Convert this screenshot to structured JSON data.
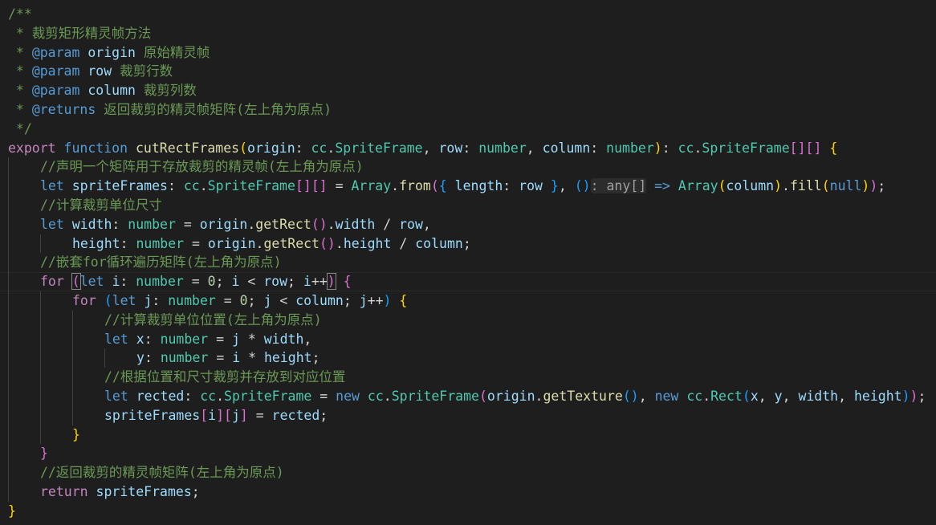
{
  "theme": {
    "background": "#1e1e1e",
    "comment": "#6a9955",
    "keyword": "#569cd6",
    "control": "#c586c0",
    "function": "#dcdcaa",
    "type": "#4ec9b0",
    "variable": "#9cdcfe",
    "number": "#b5cea8",
    "plain": "#d4d4d4",
    "bracket1": "#ffd700",
    "bracket2": "#da70d6",
    "bracket3": "#179fff"
  },
  "editor": {
    "lines": [
      {
        "indent": 0,
        "tokens": [
          [
            "/**",
            "comment"
          ]
        ]
      },
      {
        "indent": 0,
        "tokens": [
          [
            " * 裁剪矩形精灵帧方法",
            "comment"
          ]
        ]
      },
      {
        "indent": 0,
        "tokens": [
          [
            " * ",
            "comment"
          ],
          [
            "@param",
            "keyword"
          ],
          [
            " ",
            "comment"
          ],
          [
            "origin",
            "variable"
          ],
          [
            " 原始精灵帧",
            "comment"
          ]
        ]
      },
      {
        "indent": 0,
        "tokens": [
          [
            " * ",
            "comment"
          ],
          [
            "@param",
            "keyword"
          ],
          [
            " ",
            "comment"
          ],
          [
            "row",
            "variable"
          ],
          [
            " 裁剪行数",
            "comment"
          ]
        ]
      },
      {
        "indent": 0,
        "tokens": [
          [
            " * ",
            "comment"
          ],
          [
            "@param",
            "keyword"
          ],
          [
            " ",
            "comment"
          ],
          [
            "column",
            "variable"
          ],
          [
            " 裁剪列数",
            "comment"
          ]
        ]
      },
      {
        "indent": 0,
        "tokens": [
          [
            " * ",
            "comment"
          ],
          [
            "@returns",
            "keyword"
          ],
          [
            " 返回裁剪的精灵帧矩阵(左上角为原点)",
            "comment"
          ]
        ]
      },
      {
        "indent": 0,
        "tokens": [
          [
            " */",
            "comment"
          ]
        ]
      },
      {
        "indent": 0,
        "tokens": [
          [
            "export",
            "control"
          ],
          [
            " ",
            "plain"
          ],
          [
            "function",
            "keyword"
          ],
          [
            " ",
            "plain"
          ],
          [
            "cutRectFrames",
            "function"
          ],
          [
            "(",
            "bracket1"
          ],
          [
            "origin",
            "variable"
          ],
          [
            ": ",
            "plain"
          ],
          [
            "cc",
            "type"
          ],
          [
            ".",
            "plain"
          ],
          [
            "SpriteFrame",
            "type"
          ],
          [
            ", ",
            "plain"
          ],
          [
            "row",
            "variable"
          ],
          [
            ": ",
            "plain"
          ],
          [
            "number",
            "type"
          ],
          [
            ", ",
            "plain"
          ],
          [
            "column",
            "variable"
          ],
          [
            ": ",
            "plain"
          ],
          [
            "number",
            "type"
          ],
          [
            ")",
            "bracket1"
          ],
          [
            ": ",
            "plain"
          ],
          [
            "cc",
            "type"
          ],
          [
            ".",
            "plain"
          ],
          [
            "SpriteFrame",
            "type"
          ],
          [
            "[]",
            "bracket2"
          ],
          [
            "[]",
            "bracket2"
          ],
          [
            " ",
            "plain"
          ],
          [
            "{",
            "bracket1"
          ]
        ]
      },
      {
        "indent": 1,
        "tokens": [
          [
            "//声明一个矩阵用于存放裁剪的精灵帧(左上角为原点)",
            "comment"
          ]
        ]
      },
      {
        "indent": 1,
        "tokens": [
          [
            "let",
            "keyword"
          ],
          [
            " ",
            "plain"
          ],
          [
            "spriteFrames",
            "variable"
          ],
          [
            ": ",
            "plain"
          ],
          [
            "cc",
            "type"
          ],
          [
            ".",
            "plain"
          ],
          [
            "SpriteFrame",
            "type"
          ],
          [
            "[]",
            "bracket2"
          ],
          [
            "[]",
            "bracket2"
          ],
          [
            " = ",
            "plain"
          ],
          [
            "Array",
            "type"
          ],
          [
            ".",
            "plain"
          ],
          [
            "from",
            "function"
          ],
          [
            "(",
            "bracket2"
          ],
          [
            "{",
            "bracket3"
          ],
          [
            " ",
            "plain"
          ],
          [
            "length",
            "variable"
          ],
          [
            ": ",
            "plain"
          ],
          [
            "row",
            "variable"
          ],
          [
            " ",
            "plain"
          ],
          [
            "}",
            "bracket3"
          ],
          [
            ", ",
            "plain"
          ],
          [
            "()",
            "bracket3"
          ],
          [
            "hint:: any[]",
            "hint"
          ],
          [
            " => ",
            "keyword"
          ],
          [
            "Array",
            "type"
          ],
          [
            "(",
            "bracket1"
          ],
          [
            "column",
            "variable"
          ],
          [
            ")",
            "bracket1"
          ],
          [
            ".",
            "plain"
          ],
          [
            "fill",
            "function"
          ],
          [
            "(",
            "bracket1"
          ],
          [
            "null",
            "keyword"
          ],
          [
            ")",
            "bracket1"
          ],
          [
            ")",
            "bracket2"
          ],
          [
            ";",
            "plain"
          ]
        ]
      },
      {
        "indent": 1,
        "tokens": [
          [
            "//计算裁剪单位尺寸",
            "comment"
          ]
        ]
      },
      {
        "indent": 1,
        "tokens": [
          [
            "let",
            "keyword"
          ],
          [
            " ",
            "plain"
          ],
          [
            "width",
            "variable"
          ],
          [
            ": ",
            "plain"
          ],
          [
            "number",
            "type"
          ],
          [
            " = ",
            "plain"
          ],
          [
            "origin",
            "variable"
          ],
          [
            ".",
            "plain"
          ],
          [
            "getRect",
            "function"
          ],
          [
            "()",
            "bracket2"
          ],
          [
            ".",
            "plain"
          ],
          [
            "width",
            "variable"
          ],
          [
            " / ",
            "plain"
          ],
          [
            "row",
            "variable"
          ],
          [
            ",",
            "plain"
          ]
        ]
      },
      {
        "indent": 2,
        "tokens": [
          [
            "height",
            "variable"
          ],
          [
            ": ",
            "plain"
          ],
          [
            "number",
            "type"
          ],
          [
            " = ",
            "plain"
          ],
          [
            "origin",
            "variable"
          ],
          [
            ".",
            "plain"
          ],
          [
            "getRect",
            "function"
          ],
          [
            "()",
            "bracket2"
          ],
          [
            ".",
            "plain"
          ],
          [
            "height",
            "variable"
          ],
          [
            " / ",
            "plain"
          ],
          [
            "column",
            "variable"
          ],
          [
            ";",
            "plain"
          ]
        ]
      },
      {
        "indent": 1,
        "tokens": [
          [
            "//嵌套for循环遍历矩阵(左上角为原点)",
            "comment"
          ]
        ]
      },
      {
        "indent": 1,
        "current": true,
        "tokens": [
          [
            "for",
            "control"
          ],
          [
            " ",
            "plain"
          ],
          [
            "(",
            "bracket2box"
          ],
          [
            "let",
            "keyword"
          ],
          [
            " ",
            "plain"
          ],
          [
            "i",
            "variable"
          ],
          [
            ": ",
            "plain"
          ],
          [
            "number",
            "type"
          ],
          [
            " = ",
            "plain"
          ],
          [
            "0",
            "number"
          ],
          [
            "; ",
            "plain"
          ],
          [
            "i",
            "variable"
          ],
          [
            " < ",
            "plain"
          ],
          [
            "row",
            "variable"
          ],
          [
            "; ",
            "plain"
          ],
          [
            "i",
            "variable"
          ],
          [
            "++",
            "plain"
          ],
          [
            ")",
            "bracket2box"
          ],
          [
            " ",
            "plain"
          ],
          [
            "{",
            "bracket2"
          ]
        ]
      },
      {
        "indent": 2,
        "tokens": [
          [
            "for",
            "control"
          ],
          [
            " ",
            "plain"
          ],
          [
            "(",
            "bracket3"
          ],
          [
            "let",
            "keyword"
          ],
          [
            " ",
            "plain"
          ],
          [
            "j",
            "variable"
          ],
          [
            ": ",
            "plain"
          ],
          [
            "number",
            "type"
          ],
          [
            " = ",
            "plain"
          ],
          [
            "0",
            "number"
          ],
          [
            "; ",
            "plain"
          ],
          [
            "j",
            "variable"
          ],
          [
            " < ",
            "plain"
          ],
          [
            "column",
            "variable"
          ],
          [
            "; ",
            "plain"
          ],
          [
            "j",
            "variable"
          ],
          [
            "++",
            "plain"
          ],
          [
            ")",
            "bracket3"
          ],
          [
            " ",
            "plain"
          ],
          [
            "{",
            "bracket1"
          ]
        ]
      },
      {
        "indent": 3,
        "tokens": [
          [
            "//计算裁剪单位位置(左上角为原点)",
            "comment"
          ]
        ]
      },
      {
        "indent": 3,
        "tokens": [
          [
            "let",
            "keyword"
          ],
          [
            " ",
            "plain"
          ],
          [
            "x",
            "variable"
          ],
          [
            ": ",
            "plain"
          ],
          [
            "number",
            "type"
          ],
          [
            " = ",
            "plain"
          ],
          [
            "j",
            "variable"
          ],
          [
            " * ",
            "plain"
          ],
          [
            "width",
            "variable"
          ],
          [
            ",",
            "plain"
          ]
        ]
      },
      {
        "indent": 4,
        "tokens": [
          [
            "y",
            "variable"
          ],
          [
            ": ",
            "plain"
          ],
          [
            "number",
            "type"
          ],
          [
            " = ",
            "plain"
          ],
          [
            "i",
            "variable"
          ],
          [
            " * ",
            "plain"
          ],
          [
            "height",
            "variable"
          ],
          [
            ";",
            "plain"
          ]
        ]
      },
      {
        "indent": 3,
        "tokens": [
          [
            "//根据位置和尺寸裁剪并存放到对应位置",
            "comment"
          ]
        ]
      },
      {
        "indent": 3,
        "tokens": [
          [
            "let",
            "keyword"
          ],
          [
            " ",
            "plain"
          ],
          [
            "rected",
            "variable"
          ],
          [
            ": ",
            "plain"
          ],
          [
            "cc",
            "type"
          ],
          [
            ".",
            "plain"
          ],
          [
            "SpriteFrame",
            "type"
          ],
          [
            " = ",
            "plain"
          ],
          [
            "new",
            "keyword"
          ],
          [
            " ",
            "plain"
          ],
          [
            "cc",
            "type"
          ],
          [
            ".",
            "plain"
          ],
          [
            "SpriteFrame",
            "type"
          ],
          [
            "(",
            "bracket2"
          ],
          [
            "origin",
            "variable"
          ],
          [
            ".",
            "plain"
          ],
          [
            "getTexture",
            "function"
          ],
          [
            "()",
            "bracket3"
          ],
          [
            ", ",
            "plain"
          ],
          [
            "new",
            "keyword"
          ],
          [
            " ",
            "plain"
          ],
          [
            "cc",
            "type"
          ],
          [
            ".",
            "plain"
          ],
          [
            "Rect",
            "type"
          ],
          [
            "(",
            "bracket3"
          ],
          [
            "x",
            "variable"
          ],
          [
            ", ",
            "plain"
          ],
          [
            "y",
            "variable"
          ],
          [
            ", ",
            "plain"
          ],
          [
            "width",
            "variable"
          ],
          [
            ", ",
            "plain"
          ],
          [
            "height",
            "variable"
          ],
          [
            ")",
            "bracket3"
          ],
          [
            ")",
            "bracket2"
          ],
          [
            ";",
            "plain"
          ]
        ]
      },
      {
        "indent": 3,
        "tokens": [
          [
            "spriteFrames",
            "variable"
          ],
          [
            "[",
            "bracket2"
          ],
          [
            "i",
            "variable"
          ],
          [
            "]",
            "bracket2"
          ],
          [
            "[",
            "bracket2"
          ],
          [
            "j",
            "variable"
          ],
          [
            "]",
            "bracket2"
          ],
          [
            " = ",
            "plain"
          ],
          [
            "rected",
            "variable"
          ],
          [
            ";",
            "plain"
          ]
        ]
      },
      {
        "indent": 2,
        "tokens": [
          [
            "}",
            "bracket1"
          ]
        ]
      },
      {
        "indent": 1,
        "tokens": [
          [
            "}",
            "bracket2"
          ]
        ]
      },
      {
        "indent": 1,
        "tokens": [
          [
            "//返回裁剪的精灵帧矩阵(左上角为原点)",
            "comment"
          ]
        ]
      },
      {
        "indent": 1,
        "tokens": [
          [
            "return",
            "control"
          ],
          [
            " ",
            "plain"
          ],
          [
            "spriteFrames",
            "variable"
          ],
          [
            ";",
            "plain"
          ]
        ]
      },
      {
        "indent": 0,
        "tokens": [
          [
            "}",
            "bracket1"
          ]
        ]
      }
    ]
  }
}
